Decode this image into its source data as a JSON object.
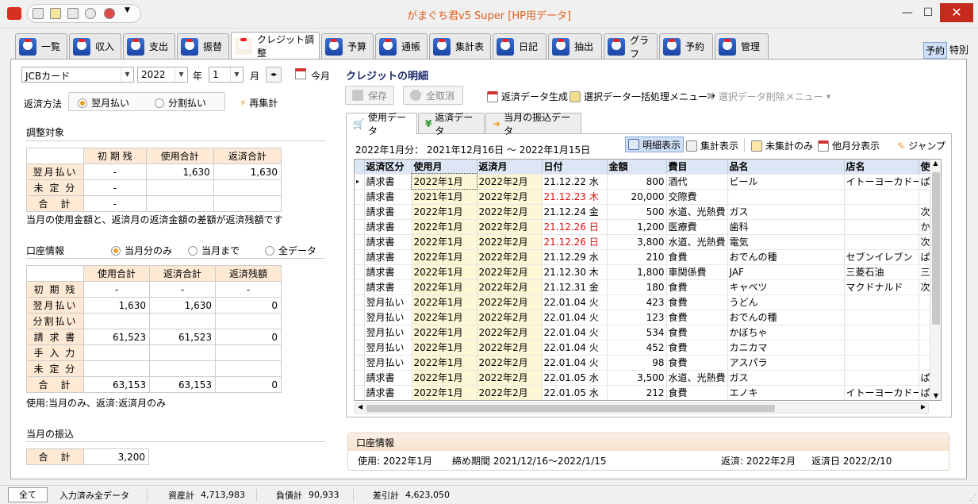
{
  "window": {
    "title": "がまぐち君v5 Super  [HP用データ]",
    "min": "—",
    "max": "☐",
    "close": "✕"
  },
  "tabs": [
    {
      "label": "一覧",
      "w": 66
    },
    {
      "label": "収入",
      "w": 66
    },
    {
      "label": "支出",
      "w": 66
    },
    {
      "label": "振替",
      "w": 66
    },
    {
      "label": "クレジット調整",
      "w": 112,
      "active": true
    },
    {
      "label": "予算",
      "w": 66
    },
    {
      "label": "通帳",
      "w": 66
    },
    {
      "label": "集計表",
      "w": 78
    },
    {
      "label": "日記",
      "w": 68
    },
    {
      "label": "抽出",
      "w": 68
    },
    {
      "label": "グラフ",
      "w": 68
    },
    {
      "label": "予約",
      "w": 68
    },
    {
      "label": "管理",
      "w": 68
    }
  ],
  "top_right": {
    "yoyaku": "予約",
    "tokubetsu": "特別"
  },
  "left": {
    "card": "JCBカード",
    "year": "2022",
    "year_unit": "年",
    "month": "1",
    "month_unit": "月",
    "this_month": "今月",
    "method_label": "返済方法",
    "method_opt1": "翌月払い",
    "method_opt2": "分割払い",
    "recalc": "再集計",
    "section1": "調整対象",
    "t1_headers": [
      "初 期 残",
      "使用合計",
      "返済合計"
    ],
    "t1_rows": [
      {
        "label": "翌月払い",
        "c": [
          "-",
          "1,630",
          "1,630"
        ]
      },
      {
        "label": "未 定 分",
        "c": [
          "-",
          "",
          ""
        ]
      },
      {
        "label": "合　計",
        "c": [
          "-",
          "",
          ""
        ]
      }
    ],
    "note1": "当月の使用金額と、返済月の返済金額の差額が返済残額です",
    "section2": "口座情報",
    "acc_opt1": "当月分のみ",
    "acc_opt2": "当月まで",
    "acc_opt3": "全データ",
    "t2_headers": [
      "使用合計",
      "返済合計",
      "返済残額"
    ],
    "t2_rows": [
      {
        "label": "初 期 残",
        "c": [
          "-",
          "-",
          "-"
        ]
      },
      {
        "label": "翌月払い",
        "c": [
          "1,630",
          "1,630",
          "0"
        ]
      },
      {
        "label": "分割払い",
        "c": [
          "",
          "",
          ""
        ]
      },
      {
        "label": "請 求 書",
        "c": [
          "61,523",
          "61,523",
          "0"
        ]
      },
      {
        "label": "手 入 力",
        "c": [
          "",
          "",
          ""
        ]
      },
      {
        "label": "未 定 分",
        "c": [
          "",
          "",
          ""
        ]
      },
      {
        "label": "合　計",
        "c": [
          "63,153",
          "63,153",
          "0"
        ]
      }
    ],
    "note2": "使用:当月のみ、返済:返済月のみ",
    "section3": "当月の振込",
    "transfer_label": "合　計",
    "transfer_value": "3,200"
  },
  "right": {
    "heading": "クレジットの明細",
    "save": "保存",
    "cancel_all": "全取消",
    "gen": "返済データ生成",
    "bulk": "選択データ一括処理メニュー",
    "del": "選択データ削除メニュー",
    "subtabs": [
      "使用データ",
      "返済データ",
      "当月の振込データ"
    ],
    "period": "2022年1月分：  2021年12月16日 ～ 2022年1月15日",
    "v_detail": "明細表示",
    "v_sum": "集計表示",
    "v_unsum": "未集計のみ",
    "v_other": "他月分表示",
    "v_jump": "ジャンプ",
    "cols": [
      "返済区分",
      "使用月",
      "返済月",
      "日付",
      "金額",
      "費目",
      "品名",
      "店名",
      "使"
    ],
    "rows": [
      [
        "請求書",
        "2022年1月",
        "2022年2月",
        "21.12.22 水",
        "800",
        "酒代",
        "ビール",
        "イトーヨーカドー",
        "ぱ"
      ],
      [
        "請求書",
        "2021年1月",
        "2022年2月",
        "21.12.23 木",
        "20,000",
        "交際費",
        "",
        "",
        ""
      ],
      [
        "請求書",
        "2022年1月",
        "2022年2月",
        "21.12.24 金",
        "500",
        "水道、光熱費",
        "ガス",
        "",
        "次"
      ],
      [
        "請求書",
        "2022年1月",
        "2022年2月",
        "21.12.26 日",
        "1,200",
        "医療費",
        "歯科",
        "",
        "か"
      ],
      [
        "請求書",
        "2022年1月",
        "2022年2月",
        "21.12.26 日",
        "3,800",
        "水道、光熱費",
        "電気",
        "",
        "次"
      ],
      [
        "請求書",
        "2022年1月",
        "2022年2月",
        "21.12.29 水",
        "210",
        "食費",
        "おでんの種",
        "セブンイレブン",
        "ぱ"
      ],
      [
        "請求書",
        "2022年1月",
        "2022年2月",
        "21.12.30 木",
        "1,800",
        "車関係費",
        "JAF",
        "三菱石油",
        "三"
      ],
      [
        "請求書",
        "2022年1月",
        "2022年2月",
        "21.12.31 金",
        "180",
        "食費",
        "キャベツ",
        "マクドナルド",
        "次"
      ],
      [
        "翌月払い",
        "2022年1月",
        "2022年2月",
        "22.01.04 火",
        "423",
        "食費",
        "うどん",
        "",
        ""
      ],
      [
        "翌月払い",
        "2022年1月",
        "2022年2月",
        "22.01.04 火",
        "123",
        "食費",
        "おでんの種",
        "",
        ""
      ],
      [
        "翌月払い",
        "2022年1月",
        "2022年2月",
        "22.01.04 火",
        "534",
        "食費",
        "かぼちゃ",
        "",
        ""
      ],
      [
        "翌月払い",
        "2022年1月",
        "2022年2月",
        "22.01.04 火",
        "452",
        "食費",
        "カニカマ",
        "",
        ""
      ],
      [
        "翌月払い",
        "2022年1月",
        "2022年2月",
        "22.01.04 火",
        "98",
        "食費",
        "アスパラ",
        "",
        ""
      ],
      [
        "請求書",
        "2022年1月",
        "2022年2月",
        "22.01.05 水",
        "3,500",
        "水道、光熱費",
        "ガス",
        "",
        "ぱ"
      ],
      [
        "請求書",
        "2022年1月",
        "2022年2月",
        "22.01.05 水",
        "212",
        "食費",
        "エノキ",
        "イトーヨーカドー",
        "ぱ"
      ]
    ],
    "red_rows": [
      1,
      3,
      4
    ],
    "info_title": "口座情報",
    "info_use": "使用: 2022年1月",
    "info_period": "締め期間  2021/12/16～2022/1/15",
    "info_repay": "返済: 2022年2月",
    "info_date": "返済日  2022/2/10"
  },
  "status": {
    "all": "全て",
    "mode": "入力済み全データ",
    "assets_label": "資産計",
    "assets": "4,713,983",
    "debt_label": "負債計",
    "debt": "90,933",
    "net_label": "差引計",
    "net": "4,623,050"
  }
}
